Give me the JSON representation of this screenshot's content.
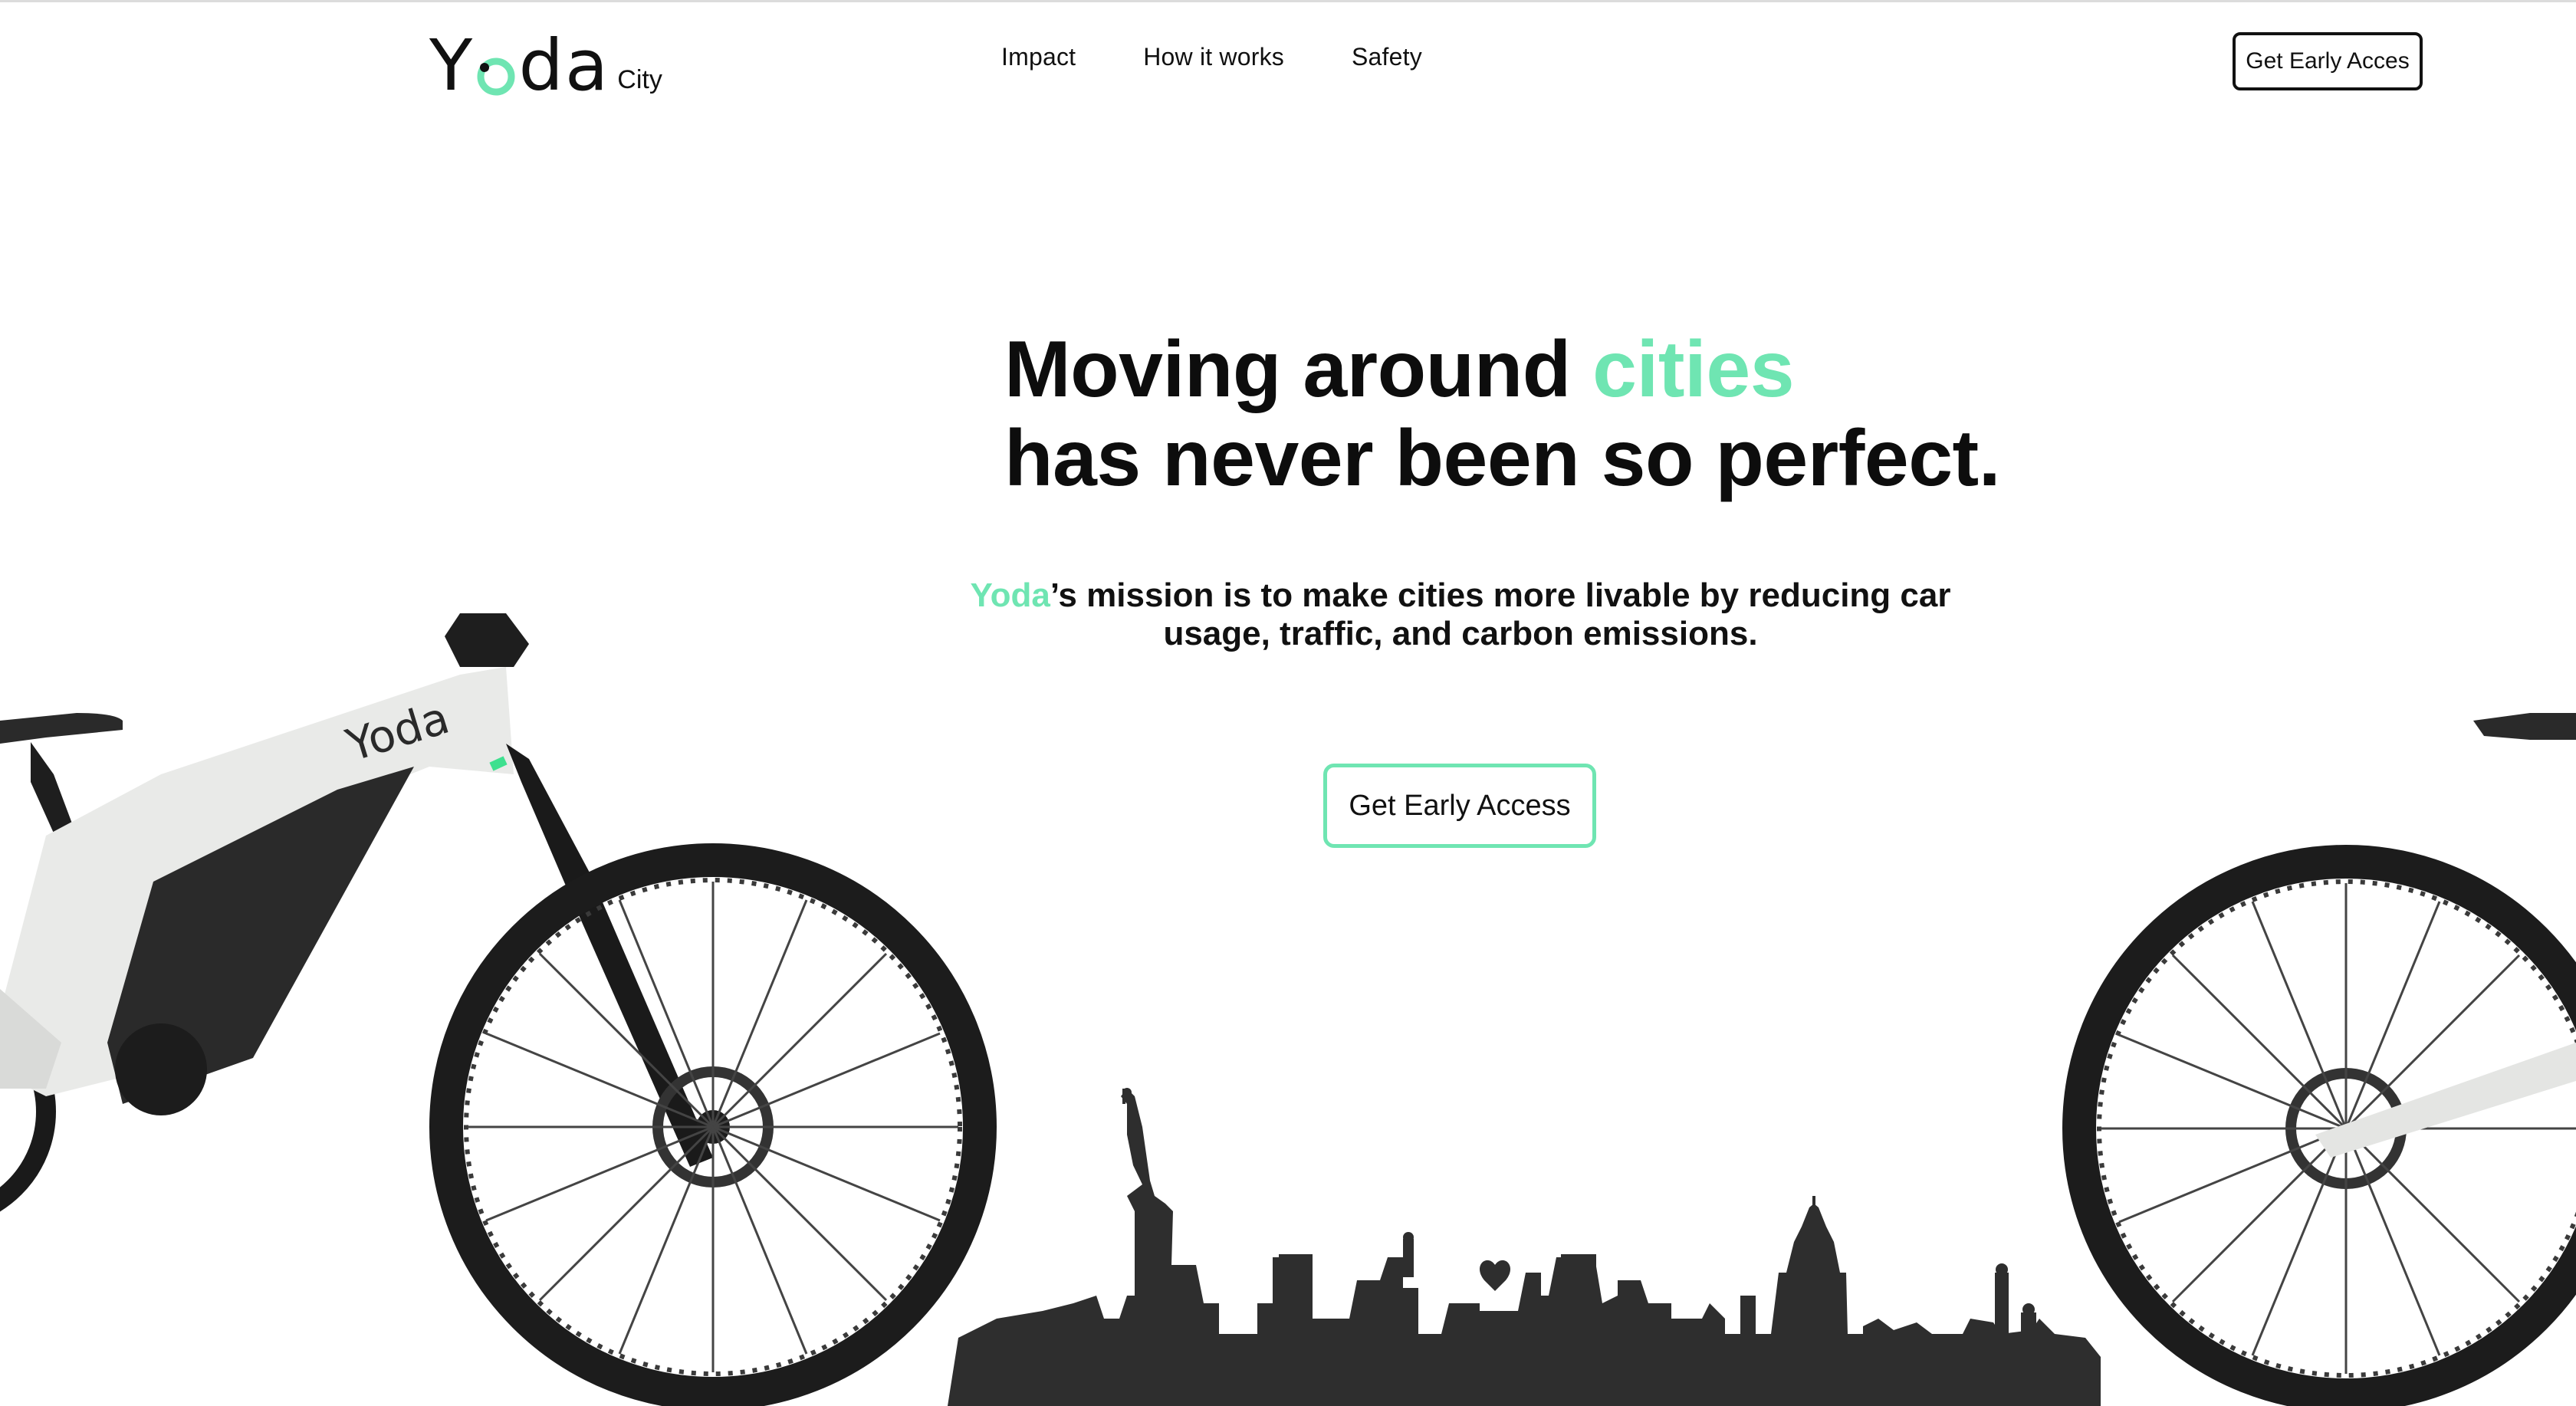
{
  "header": {
    "logo_word_y": "Y",
    "logo_word_da": "da",
    "logo_sub": "City",
    "nav": [
      {
        "label": "Impact"
      },
      {
        "label": "How it works"
      },
      {
        "label": "Safety"
      }
    ],
    "cta_label": "Get Early Acces"
  },
  "hero": {
    "headline_line1_prefix": "Moving around ",
    "headline_line1_accent": "cities",
    "headline_line2": "has never been so perfect.",
    "mission_brand": "Yoda",
    "mission_rest": "’s mission is to make cities more livable by reducing car usage, traffic, and carbon emissions.",
    "cta_label": "Get Early Access"
  },
  "bike": {
    "frame_brand": "Yoda"
  },
  "colors": {
    "accent": "#6fe5b2",
    "text": "#0d0d0d",
    "skyline": "#2e2e2e"
  }
}
